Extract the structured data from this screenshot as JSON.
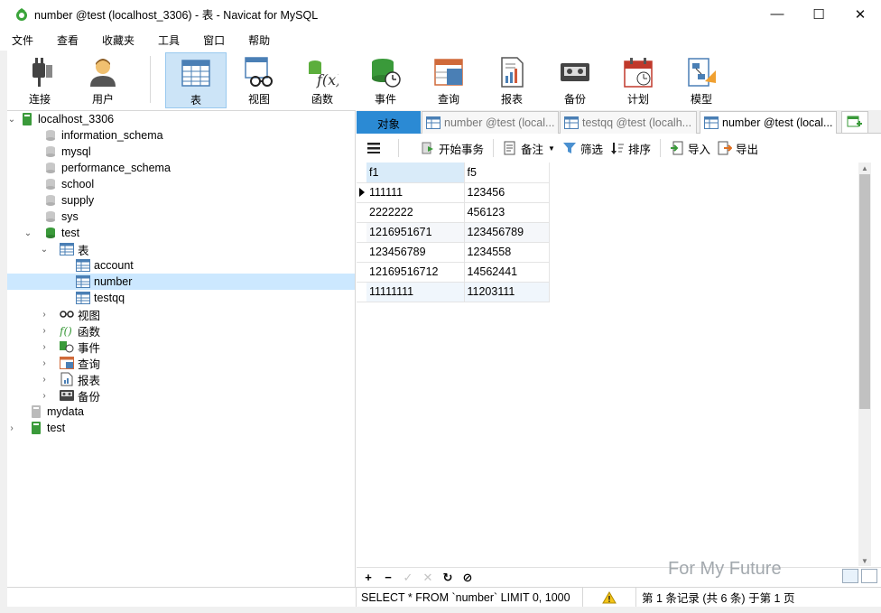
{
  "window": {
    "title": "number @test (localhost_3306) - 表 - Navicat for MySQL",
    "controls": {
      "minimize": "—",
      "maximize": "☐",
      "close": "✕"
    }
  },
  "menu": [
    "文件",
    "查看",
    "收藏夹",
    "工具",
    "窗口",
    "帮助"
  ],
  "toolbar": {
    "buttons": [
      {
        "label": "连接",
        "icon": "plug-icon"
      },
      {
        "label": "用户",
        "icon": "user-icon"
      },
      {
        "label": "表",
        "icon": "table-icon",
        "active": true
      },
      {
        "label": "视图",
        "icon": "view-icon"
      },
      {
        "label": "函数",
        "icon": "function-icon"
      },
      {
        "label": "事件",
        "icon": "event-icon"
      },
      {
        "label": "查询",
        "icon": "query-icon"
      },
      {
        "label": "报表",
        "icon": "report-icon"
      },
      {
        "label": "备份",
        "icon": "backup-icon"
      },
      {
        "label": "计划",
        "icon": "schedule-icon"
      },
      {
        "label": "模型",
        "icon": "model-icon"
      }
    ]
  },
  "tree": {
    "connection": "localhost_3306",
    "databases": [
      "information_schema",
      "mysql",
      "performance_schema",
      "school",
      "supply",
      "sys",
      "test"
    ],
    "tables_group": "表",
    "tables": [
      "account",
      "number",
      "testqq"
    ],
    "selected_table": "number",
    "groups": [
      "视图",
      "函数",
      "事件",
      "查询",
      "报表",
      "备份"
    ],
    "other_connections": [
      "mydata",
      "test"
    ]
  },
  "tabs": {
    "objects": "对象",
    "items": [
      {
        "label": "number @test (local...",
        "active": false
      },
      {
        "label": "testqq @test (localh...",
        "active": false
      },
      {
        "label": "number @test (local...",
        "active": true
      }
    ]
  },
  "subtoolbar": {
    "begin_transaction": "开始事务",
    "memo": "备注",
    "filter": "筛选",
    "sort": "排序",
    "import": "导入",
    "export": "导出"
  },
  "grid": {
    "columns": [
      "f1",
      "f5"
    ],
    "rows": [
      [
        "111111",
        "123456"
      ],
      [
        "2222222",
        "456123"
      ],
      [
        "1216951671",
        "123456789"
      ],
      [
        "123456789",
        "1234558"
      ],
      [
        "12169516712",
        "14562441"
      ],
      [
        "11111111",
        "11203111"
      ]
    ]
  },
  "navbar": {
    "add": "+",
    "remove": "−",
    "apply": "✓",
    "cancel": "✕",
    "refresh": "↻",
    "stop": "⊘"
  },
  "watermark": "For My Future",
  "status": {
    "sql": "SELECT * FROM `number` LIMIT 0, 1000",
    "page": "第 1 条记录 (共 6 条) 于第 1 页"
  },
  "colors": {
    "accent": "#2b8ad4",
    "selection": "#cce8ff",
    "active_toolbar": "#cce4f7"
  }
}
